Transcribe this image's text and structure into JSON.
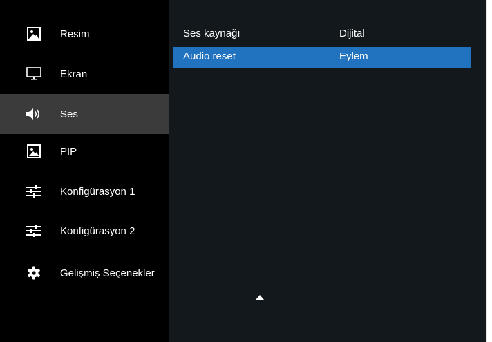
{
  "sidebar": {
    "items": [
      {
        "label": "Resim",
        "icon": "picture-icon"
      },
      {
        "label": "Ekran",
        "icon": "monitor-icon"
      },
      {
        "label": "Ses",
        "icon": "speaker-icon",
        "active": true
      },
      {
        "label": "PIP",
        "icon": "picture-icon"
      },
      {
        "label": "Konfigürasyon 1",
        "icon": "sliders-icon"
      },
      {
        "label": "Konfigürasyon 2",
        "icon": "sliders-icon"
      },
      {
        "label": "Gelişmiş Seçenekler",
        "icon": "gear-icon"
      }
    ]
  },
  "content": {
    "rows": [
      {
        "label": "Ses kaynağı",
        "value": "Dijital"
      },
      {
        "label": "Audio reset",
        "value": "Eylem",
        "selected": true
      }
    ],
    "scroll_icon": "triangle-up-icon"
  },
  "colors": {
    "sidebar_bg": "#000000",
    "active_item_bg": "#3b3b3b",
    "content_bg": "#12181c",
    "selected_row_bg": "#2173bf",
    "text": "#ffffff"
  }
}
